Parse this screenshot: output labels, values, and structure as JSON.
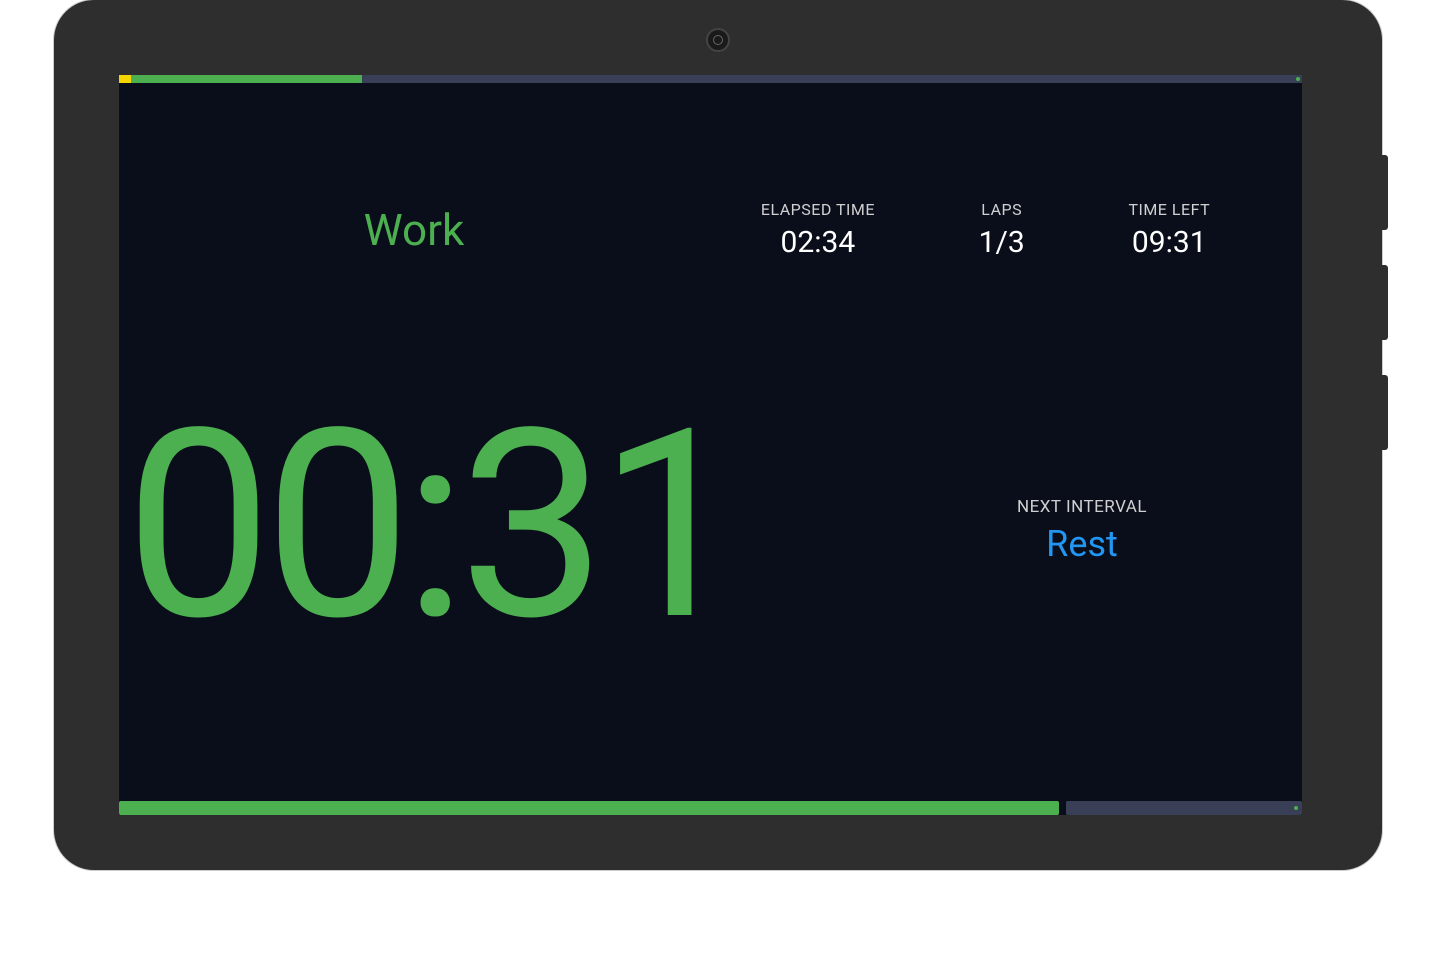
{
  "phase": {
    "label": "Work",
    "color": "#4caf50"
  },
  "stats": {
    "elapsed": {
      "label": "ELAPSED TIME",
      "value": "02:34"
    },
    "laps": {
      "label": "LAPS",
      "value": "1/3"
    },
    "timeLeft": {
      "label": "TIME LEFT",
      "value": "09:31"
    }
  },
  "timer": {
    "value": "00:31"
  },
  "nextInterval": {
    "label": "NEXT INTERVAL",
    "value": "Rest",
    "color": "#2196f3"
  },
  "progress": {
    "top": {
      "warmupPercent": 1.0,
      "workPercent": 19.5
    },
    "bottom": {
      "currentPercent": 79.5
    }
  }
}
